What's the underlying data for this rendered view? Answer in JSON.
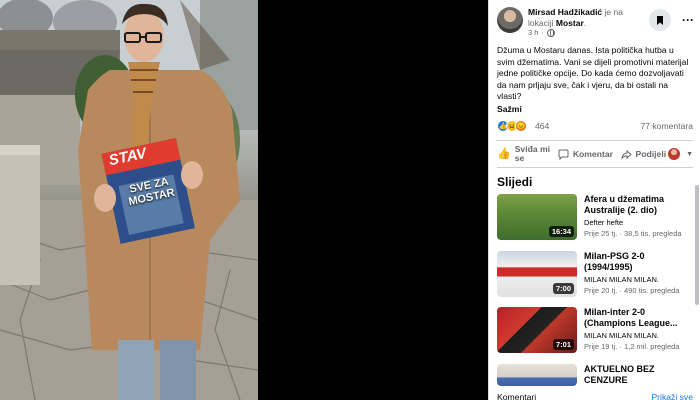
{
  "post": {
    "author": "Mirsad Hadžikadić",
    "location_prefix": "je na lokaciji",
    "location": "Mostar",
    "time": "3 h",
    "text": "Džuma u Mostaru danas. Ista politička hutba u svim džematima. Vani se dijeli promotivni materijal jedne političke opcije. Do kada ćemo dozvoljavati da nam prljaju sve, čak i vjeru, da bi ostali na vlasti?",
    "see_less": "Sažmi",
    "reaction_count": "464",
    "comment_count": "77 komentara"
  },
  "actions": {
    "like": "Sviđa mi se",
    "comment": "Komentar",
    "share": "Podijeli"
  },
  "follow": {
    "title": "Slijedi",
    "videos": [
      {
        "title": "Afera u džematima Australije (2. dio)",
        "channel": "Defter hefte",
        "meta": "Prije 25 tj. · 38,5 tis. pregleda",
        "duration": "16:34"
      },
      {
        "title": "Milan-PSG 2-0 (1994/1995)",
        "channel": "MILAN MILAN MILAN.",
        "meta": "Prije 20 tj. · 490 tis. pregleda",
        "duration": "7:00"
      },
      {
        "title": "Milan-inter 2-0 (Champions League...",
        "channel": "MILAN MILAN MILAN.",
        "meta": "Prije 19 tj. · 1,2 mil. pregleda",
        "duration": "7:01"
      },
      {
        "title": "AKTUELNO BEZ CENZURE",
        "channel": "",
        "meta": "",
        "duration": ""
      }
    ]
  },
  "comments_bar": {
    "label": "Komentari",
    "link": "Prikaži sve"
  },
  "photo": {
    "magazine_brand": "STAV",
    "magazine_headline": "SVE ZA MOSTAR"
  },
  "icons": {
    "save": "bookmark-icon",
    "more": "more-options-icon",
    "like": "thumbs-up-icon",
    "comment": "comment-icon",
    "share": "share-icon"
  },
  "colors": {
    "accent": "#1877f2",
    "secondary_text": "#65676b",
    "background": "#000000"
  }
}
